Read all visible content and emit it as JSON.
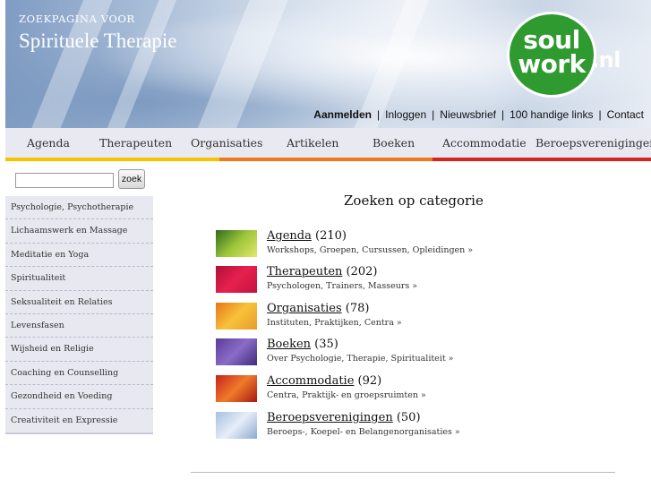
{
  "header": {
    "subtitle": "ZOEKPAGINA VOOR",
    "title": "Spirituele Therapie",
    "logo": {
      "line1": "soul",
      "line2": "work",
      "suffix": ".nl",
      "color": "#2f9a2f"
    }
  },
  "toplinks": [
    {
      "label": "Aanmelden",
      "bold": true
    },
    {
      "label": "Inloggen"
    },
    {
      "label": "Nieuwsbrief"
    },
    {
      "label": "100 handige links"
    },
    {
      "label": "Contact"
    }
  ],
  "nav": [
    {
      "label": "Agenda"
    },
    {
      "label": "Therapeuten"
    },
    {
      "label": "Organisaties"
    },
    {
      "label": "Artikelen"
    },
    {
      "label": "Boeken"
    },
    {
      "label": "Accommodatie"
    },
    {
      "label": "Beroepsverenigingen"
    }
  ],
  "stripe_colors": [
    "#f5c400",
    "#ef7a1a",
    "#d8231f"
  ],
  "search": {
    "button_label": "zoek",
    "placeholder": ""
  },
  "sidebar": [
    {
      "label": "Psychologie, Psychotherapie"
    },
    {
      "label": "Lichaamswerk en Massage"
    },
    {
      "label": "Meditatie en Yoga"
    },
    {
      "label": "Spiritualiteit"
    },
    {
      "label": "Seksualiteit en Relaties"
    },
    {
      "label": "Levensfasen"
    },
    {
      "label": "Wijsheid en Religie"
    },
    {
      "label": "Coaching en Counselling"
    },
    {
      "label": "Gezondheid en Voeding"
    },
    {
      "label": "Creativiteit en Expressie"
    }
  ],
  "main": {
    "heading": "Zoeken op categorie",
    "categories": [
      {
        "name": "Agenda",
        "count": "(210)",
        "desc": "Workshops, Groepen, Cursussen, Opleidingen »",
        "thumb_colors": [
          "#2f6b1c",
          "#9cc53a",
          "#e4e86a"
        ]
      },
      {
        "name": "Therapeuten",
        "count": "(202)",
        "desc": "Psychologen, Trainers, Masseurs »",
        "thumb_colors": [
          "#b0103a",
          "#e8204e",
          "#c0143f"
        ]
      },
      {
        "name": "Organisaties",
        "count": "(78)",
        "desc": "Instituten, Praktijken, Centra »",
        "thumb_colors": [
          "#e7761a",
          "#f7c23a",
          "#e99a2a"
        ]
      },
      {
        "name": "Boeken",
        "count": "(35)",
        "desc": "Over Psychologie, Therapie, Spiritualiteit »",
        "thumb_colors": [
          "#5a3d9a",
          "#8a6cc8",
          "#3f2b7a"
        ]
      },
      {
        "name": "Accommodatie",
        "count": "(92)",
        "desc": "Centra, Praktijk- en groepsruimten »",
        "thumb_colors": [
          "#c7221a",
          "#f07a2a",
          "#a81812"
        ]
      },
      {
        "name": "Beroepsverenigingen",
        "count": "(50)",
        "desc": "Beroeps-, Koepel- en Belangenorganisaties »",
        "thumb_colors": [
          "#a8bfe0",
          "#e6eef8",
          "#8ea9d2"
        ]
      }
    ]
  }
}
